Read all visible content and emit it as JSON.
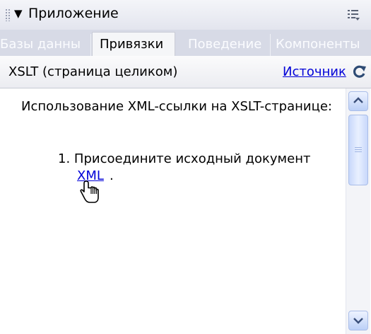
{
  "panel": {
    "title": "Приложение",
    "collapse_icon": "triangle-down-icon",
    "options_icon": "panel-options-icon"
  },
  "tabs": [
    {
      "label": "Базы данны",
      "active": false
    },
    {
      "label": "Привязки",
      "active": true
    },
    {
      "label": "Поведение",
      "active": false
    },
    {
      "label": "Компоненты",
      "active": false
    }
  ],
  "doc_bar": {
    "label": "XSLT (страница целиком)",
    "source_link": "Источник",
    "refresh_icon": "refresh-icon"
  },
  "content": {
    "intro": "Использование XML-ссылки на XSLT-странице:",
    "step_number": "1.",
    "step_text": "Присоедините исходный документ",
    "step_link": "XML",
    "step_end": "."
  },
  "colors": {
    "link": "#0000d8",
    "tabbar_bg": "#d7dae6",
    "scroll_accent": "#bcd0f7"
  }
}
